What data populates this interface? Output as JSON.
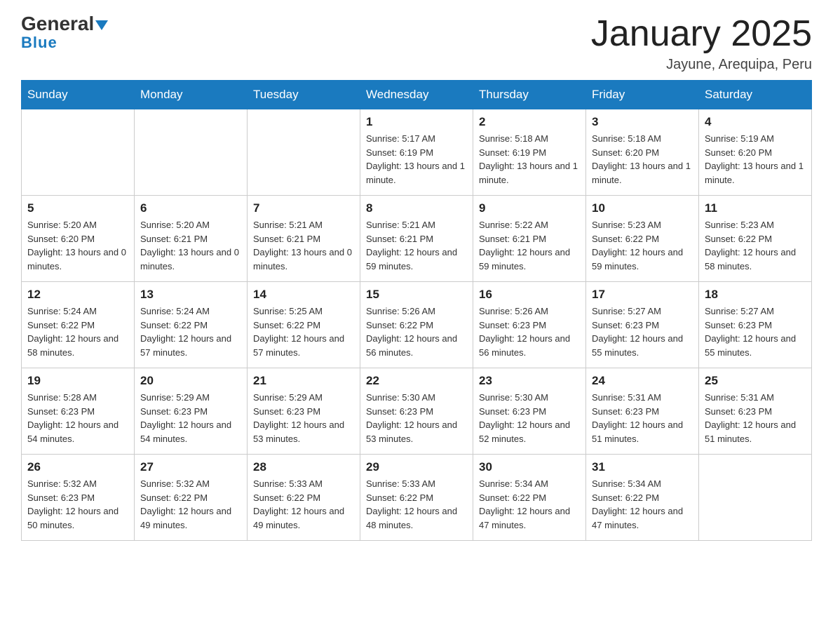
{
  "header": {
    "logo_main": "General",
    "logo_sub": "Blue",
    "month_title": "January 2025",
    "location": "Jayune, Arequipa, Peru"
  },
  "days_of_week": [
    "Sunday",
    "Monday",
    "Tuesday",
    "Wednesday",
    "Thursday",
    "Friday",
    "Saturday"
  ],
  "weeks": [
    [
      {
        "day": "",
        "info": ""
      },
      {
        "day": "",
        "info": ""
      },
      {
        "day": "",
        "info": ""
      },
      {
        "day": "1",
        "info": "Sunrise: 5:17 AM\nSunset: 6:19 PM\nDaylight: 13 hours and 1 minute."
      },
      {
        "day": "2",
        "info": "Sunrise: 5:18 AM\nSunset: 6:19 PM\nDaylight: 13 hours and 1 minute."
      },
      {
        "day": "3",
        "info": "Sunrise: 5:18 AM\nSunset: 6:20 PM\nDaylight: 13 hours and 1 minute."
      },
      {
        "day": "4",
        "info": "Sunrise: 5:19 AM\nSunset: 6:20 PM\nDaylight: 13 hours and 1 minute."
      }
    ],
    [
      {
        "day": "5",
        "info": "Sunrise: 5:20 AM\nSunset: 6:20 PM\nDaylight: 13 hours and 0 minutes."
      },
      {
        "day": "6",
        "info": "Sunrise: 5:20 AM\nSunset: 6:21 PM\nDaylight: 13 hours and 0 minutes."
      },
      {
        "day": "7",
        "info": "Sunrise: 5:21 AM\nSunset: 6:21 PM\nDaylight: 13 hours and 0 minutes."
      },
      {
        "day": "8",
        "info": "Sunrise: 5:21 AM\nSunset: 6:21 PM\nDaylight: 12 hours and 59 minutes."
      },
      {
        "day": "9",
        "info": "Sunrise: 5:22 AM\nSunset: 6:21 PM\nDaylight: 12 hours and 59 minutes."
      },
      {
        "day": "10",
        "info": "Sunrise: 5:23 AM\nSunset: 6:22 PM\nDaylight: 12 hours and 59 minutes."
      },
      {
        "day": "11",
        "info": "Sunrise: 5:23 AM\nSunset: 6:22 PM\nDaylight: 12 hours and 58 minutes."
      }
    ],
    [
      {
        "day": "12",
        "info": "Sunrise: 5:24 AM\nSunset: 6:22 PM\nDaylight: 12 hours and 58 minutes."
      },
      {
        "day": "13",
        "info": "Sunrise: 5:24 AM\nSunset: 6:22 PM\nDaylight: 12 hours and 57 minutes."
      },
      {
        "day": "14",
        "info": "Sunrise: 5:25 AM\nSunset: 6:22 PM\nDaylight: 12 hours and 57 minutes."
      },
      {
        "day": "15",
        "info": "Sunrise: 5:26 AM\nSunset: 6:22 PM\nDaylight: 12 hours and 56 minutes."
      },
      {
        "day": "16",
        "info": "Sunrise: 5:26 AM\nSunset: 6:23 PM\nDaylight: 12 hours and 56 minutes."
      },
      {
        "day": "17",
        "info": "Sunrise: 5:27 AM\nSunset: 6:23 PM\nDaylight: 12 hours and 55 minutes."
      },
      {
        "day": "18",
        "info": "Sunrise: 5:27 AM\nSunset: 6:23 PM\nDaylight: 12 hours and 55 minutes."
      }
    ],
    [
      {
        "day": "19",
        "info": "Sunrise: 5:28 AM\nSunset: 6:23 PM\nDaylight: 12 hours and 54 minutes."
      },
      {
        "day": "20",
        "info": "Sunrise: 5:29 AM\nSunset: 6:23 PM\nDaylight: 12 hours and 54 minutes."
      },
      {
        "day": "21",
        "info": "Sunrise: 5:29 AM\nSunset: 6:23 PM\nDaylight: 12 hours and 53 minutes."
      },
      {
        "day": "22",
        "info": "Sunrise: 5:30 AM\nSunset: 6:23 PM\nDaylight: 12 hours and 53 minutes."
      },
      {
        "day": "23",
        "info": "Sunrise: 5:30 AM\nSunset: 6:23 PM\nDaylight: 12 hours and 52 minutes."
      },
      {
        "day": "24",
        "info": "Sunrise: 5:31 AM\nSunset: 6:23 PM\nDaylight: 12 hours and 51 minutes."
      },
      {
        "day": "25",
        "info": "Sunrise: 5:31 AM\nSunset: 6:23 PM\nDaylight: 12 hours and 51 minutes."
      }
    ],
    [
      {
        "day": "26",
        "info": "Sunrise: 5:32 AM\nSunset: 6:23 PM\nDaylight: 12 hours and 50 minutes."
      },
      {
        "day": "27",
        "info": "Sunrise: 5:32 AM\nSunset: 6:22 PM\nDaylight: 12 hours and 49 minutes."
      },
      {
        "day": "28",
        "info": "Sunrise: 5:33 AM\nSunset: 6:22 PM\nDaylight: 12 hours and 49 minutes."
      },
      {
        "day": "29",
        "info": "Sunrise: 5:33 AM\nSunset: 6:22 PM\nDaylight: 12 hours and 48 minutes."
      },
      {
        "day": "30",
        "info": "Sunrise: 5:34 AM\nSunset: 6:22 PM\nDaylight: 12 hours and 47 minutes."
      },
      {
        "day": "31",
        "info": "Sunrise: 5:34 AM\nSunset: 6:22 PM\nDaylight: 12 hours and 47 minutes."
      },
      {
        "day": "",
        "info": ""
      }
    ]
  ]
}
